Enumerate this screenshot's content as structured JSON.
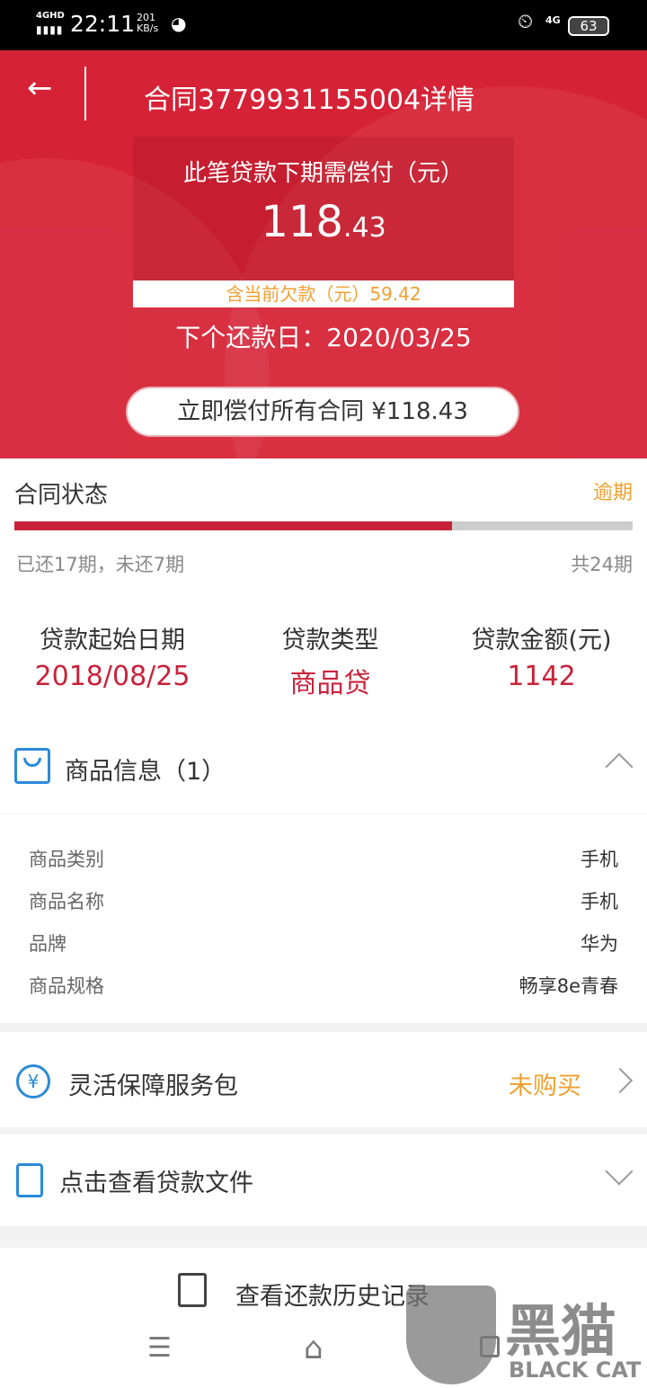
{
  "status_bar": {
    "network": "4GHD",
    "time": "22:11",
    "speed": "201",
    "speed_unit": "KB/s",
    "net2": "4G",
    "battery": "63"
  },
  "header": {
    "title": "合同3779931155004详情",
    "due_label": "此笔贷款下期需偿付（元）",
    "due_int": "118",
    "due_dec": ".43",
    "owed": "含当前欠款（元）59.42",
    "next_date": "下个还款日：2020/03/25",
    "pay_all": "立即偿付所有合同 ¥118.43"
  },
  "contract": {
    "title": "合同状态",
    "status": "逾期",
    "progress": 0.7083,
    "paid_text": "已还17期，未还7期",
    "total_text": "共24期"
  },
  "info": [
    {
      "label": "贷款起始日期",
      "value": "2018/08/25"
    },
    {
      "label": "贷款类型",
      "value": "商品贷"
    },
    {
      "label": "贷款金额(元)",
      "value": "1142"
    }
  ],
  "product": {
    "title": "商品信息（1）",
    "rows": [
      {
        "k": "商品类别",
        "v": "手机"
      },
      {
        "k": "商品名称",
        "v": "手机"
      },
      {
        "k": "品牌",
        "v": "华为"
      },
      {
        "k": "商品规格",
        "v": "畅享8e青春"
      }
    ]
  },
  "service": {
    "title": "灵活保障服务包",
    "status": "未购买"
  },
  "docs": {
    "title": "点击查看贷款文件"
  },
  "history": {
    "title": "查看还款历史记录"
  },
  "watermark": {
    "cn": "黑猫",
    "en": "BLACK CAT"
  },
  "colors": {
    "red": "#d62236",
    "orange": "#f0a030",
    "value_red": "#c8223a",
    "blue": "#2a8ad8"
  }
}
